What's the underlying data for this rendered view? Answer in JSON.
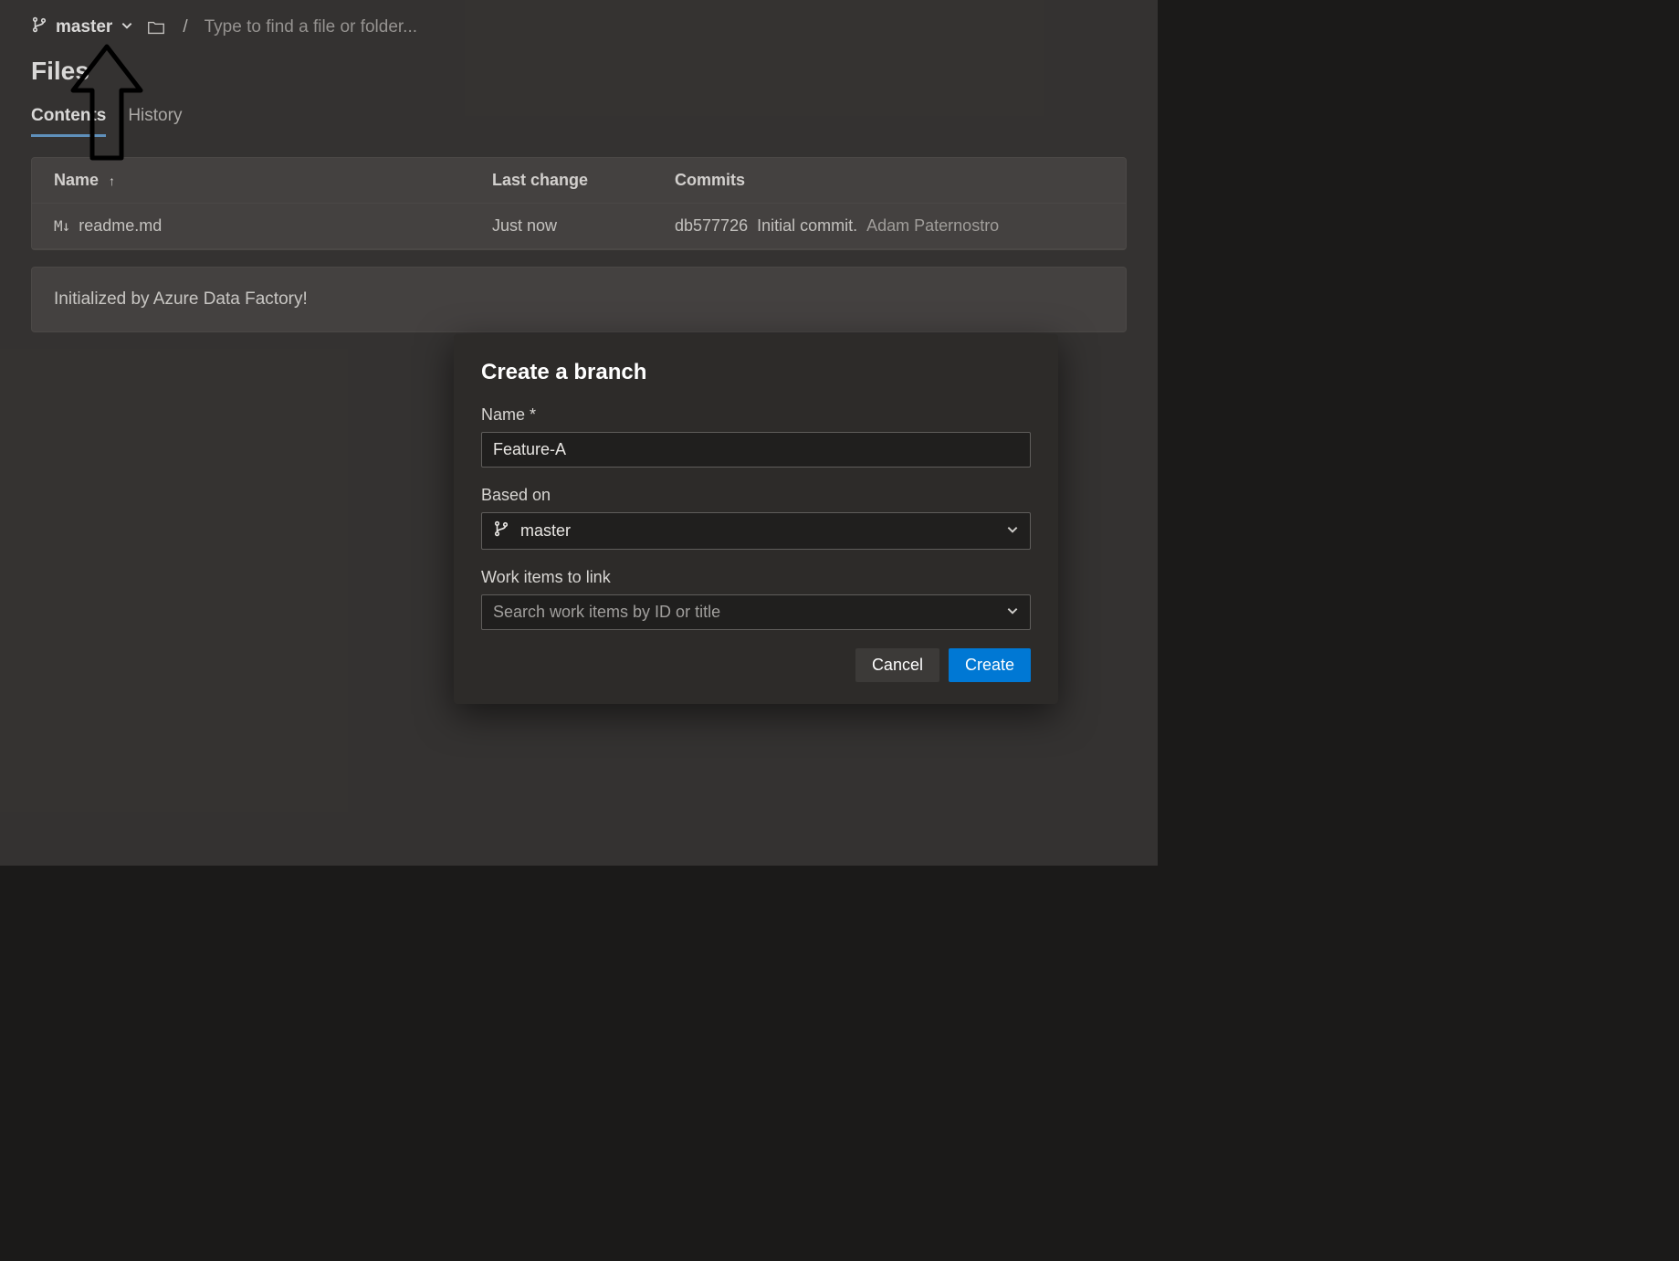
{
  "crumb": {
    "branch": "master",
    "search_placeholder": "Type to find a file or folder..."
  },
  "page_title": "Files",
  "tabs": {
    "contents": "Contents",
    "history": "History"
  },
  "table": {
    "head": {
      "name": "Name",
      "last_change": "Last change",
      "commits": "Commits"
    },
    "rows": [
      {
        "file_glyph": "M↓",
        "name": "readme.md",
        "last_change": "Just now",
        "commit_hash": "db577726",
        "commit_msg": "Initial commit.",
        "commit_author": "Adam Paternostro"
      }
    ]
  },
  "readme_text": "Initialized by Azure Data Factory!",
  "dialog": {
    "title": "Create a branch",
    "name_label": "Name *",
    "name_value": "Feature-A",
    "based_on_label": "Based on",
    "based_on_value": "master",
    "work_items_label": "Work items to link",
    "work_items_placeholder": "Search work items by ID or title",
    "cancel": "Cancel",
    "create": "Create"
  }
}
